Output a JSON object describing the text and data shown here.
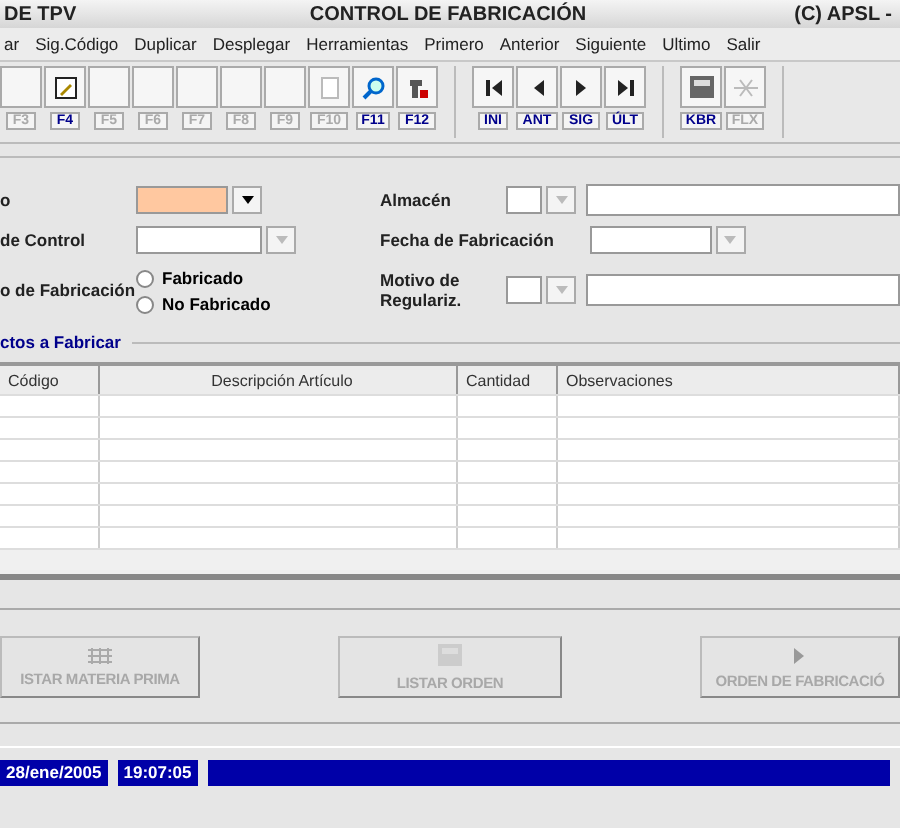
{
  "window": {
    "title_left": "DE TPV",
    "title": "CONTROL DE FABRICACIÓN",
    "title_right": "(C) APSL -"
  },
  "menu": [
    "ar",
    "Sig.Código",
    "Duplicar",
    "Desplegar",
    "Herramientas",
    "Primero",
    "Anterior",
    "Siguiente",
    "Ultimo",
    "Salir"
  ],
  "toolbar_groups": [
    [
      {
        "key": "F3",
        "kind": "blank",
        "disabled": true
      },
      {
        "key": "F4",
        "kind": "edit",
        "disabled": false
      },
      {
        "key": "F5",
        "kind": "blank",
        "disabled": true
      },
      {
        "key": "F6",
        "kind": "blank",
        "disabled": true
      },
      {
        "key": "F7",
        "kind": "blank",
        "disabled": true
      },
      {
        "key": "F8",
        "kind": "blank",
        "disabled": true
      },
      {
        "key": "F9",
        "kind": "blank",
        "disabled": true
      },
      {
        "key": "F10",
        "kind": "page",
        "disabled": true
      },
      {
        "key": "F11",
        "kind": "search",
        "disabled": false
      },
      {
        "key": "F12",
        "kind": "tool",
        "disabled": false
      }
    ],
    [
      {
        "key": "INI",
        "kind": "first",
        "disabled": false
      },
      {
        "key": "ANT",
        "kind": "prev",
        "disabled": false
      },
      {
        "key": "SIG",
        "kind": "next",
        "disabled": false
      },
      {
        "key": "ÚLT",
        "kind": "last",
        "disabled": false
      }
    ],
    [
      {
        "key": "KBR",
        "kind": "printer",
        "disabled": false
      },
      {
        "key": "FLX",
        "kind": "cross",
        "disabled": true
      }
    ]
  ],
  "form": {
    "tipo_label": "o",
    "control_label": "de Control",
    "estado_label": "o de Fabricación",
    "radios": [
      {
        "label": "Fabricado",
        "selected": false
      },
      {
        "label": "No Fabricado",
        "selected": false
      }
    ],
    "almacen_label": "Almacén",
    "fecha_label": "Fecha de Fabricación",
    "motivo_label": "Motivo de\nRegulariz."
  },
  "section": "ctos a Fabricar",
  "table": {
    "columns": [
      "Código",
      "Descripción Artículo",
      "Cantidad",
      "Observaciones"
    ]
  },
  "actions": [
    {
      "label": "ISTAR MATERIA PRIMA",
      "kind": "grid",
      "disabled": true
    },
    {
      "label": "LISTAR ORDEN",
      "kind": "printer",
      "disabled": true
    },
    {
      "label": "ORDEN DE FABRICACIÓ",
      "kind": "arrow",
      "disabled": true
    }
  ],
  "status": {
    "date": "28/ene/2005",
    "time": "19:07:05"
  }
}
